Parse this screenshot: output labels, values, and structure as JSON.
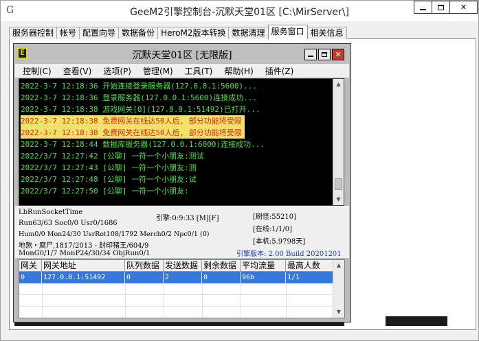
{
  "window": {
    "app_icon": "G",
    "title": "GeeM2引擎控制台-沉默天堂01区 [C:\\MirServer\\]"
  },
  "tabs": [
    "服务器控制",
    "帐号",
    "配置向导",
    "数据备份",
    "HeroM2版本转换",
    "数据清理",
    "服务窗口",
    "相关信息"
  ],
  "inner": {
    "logo": "E",
    "title": "沉默天堂01区 [无限版]",
    "menu": [
      "控制(C)",
      "查看(V)",
      "选项(P)",
      "管理(M)",
      "工具(T)",
      "帮助(H)",
      "插件(Z)"
    ]
  },
  "log": [
    "2022-3-7 12:18:36 开始连接登录服务器(127.0.0.1:5600)...",
    "2022-3-7 12:18:36 登录服务器(127.0.0.1:5600)连接成功...",
    "2022-3-7 12:18:38 游戏网关[0](127.0.0.1:51492)已打开...",
    "2022-3-7 12:18:38 免费网关在线达50人后, 部分功能将受限",
    "2022-3-7 12:18:38 免费网关在线达50人后, 部分功能将受限",
    "2022-3-7 12:18:44 数据库服务器(127.0.0.1:6000)连接成功...",
    "2022/3/7 12:27:42 [公聊] 一符一个小朋友:测试",
    "2022/3/7 12:27:43 [公聊] 一符一个小朋友:测",
    "2022/3/7 12:27:48 [公聊] 一符一个小朋友:试",
    "2022/3/7 12:27:50 [公聊] 一符一个小朋友:"
  ],
  "stats": {
    "socket_time": "LbRunSocketTime",
    "run": "Run63/63 Soc0/0 Usr0/1686",
    "hum": "Hum0/0 Mon24/30 UsrRot108/1792 Merch0/2 Npc0/1 (0)",
    "map": "地煞・腐尸,1817/2013 - 封印猪王/604/9",
    "mon": "MonG0/1/7 MonP24/30/34 ObjRun0/1",
    "uptime": "引擎:0:9:33 [M][F]",
    "refresh": "[刷怪:55210]",
    "online": "[在线:1/1/0]",
    "local": "[本机:5.9798天]",
    "version": "引擎版本: 2.00 Build 20201201"
  },
  "table": {
    "headers": [
      "网关",
      "网关地址",
      "队列数据",
      "发送数据",
      "剩余数据",
      "平均流量",
      "最高人数"
    ],
    "row": [
      "0",
      "127.0.0.1:51492",
      "0",
      "2",
      "0",
      "96b",
      "1/1"
    ]
  }
}
